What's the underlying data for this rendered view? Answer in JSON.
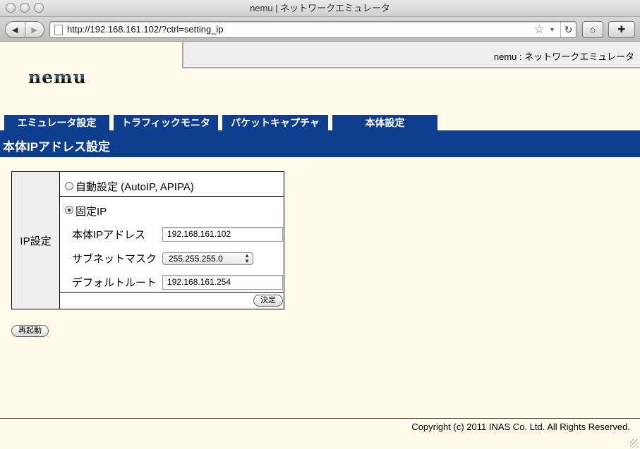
{
  "window": {
    "title": "nemu | ネットワークエミュレータ"
  },
  "browser": {
    "url": "http://192.168.161.102/?ctrl=setting_ip",
    "back_icon": "◀",
    "forward_icon": "▶",
    "star_icon": "☆",
    "dropdown_icon": "▾",
    "reload_icon": "↻",
    "home_icon": "⌂",
    "bookmarks_icon": "✚"
  },
  "header": {
    "title": "nemu : ネットワークエミュレータ",
    "logo": "nemu"
  },
  "tabs": [
    {
      "label": "エミュレータ設定"
    },
    {
      "label": "トラフィックモニタ"
    },
    {
      "label": "パケットキャプチャ"
    },
    {
      "label": "本体設定"
    }
  ],
  "section": {
    "title": "本体IPアドレス設定"
  },
  "form": {
    "row_label": "IP設定",
    "auto_option": {
      "label": "自動設定 (AutoIP, APIPA)",
      "checked": false
    },
    "static_option": {
      "label": "固定IP",
      "checked": true
    },
    "fields": {
      "ip_label": "本体IPアドレス",
      "ip_value": "192.168.161.102",
      "mask_label": "サブネットマスク",
      "mask_value": "255.255.255.0",
      "gateway_label": "デフォルトルート",
      "gateway_value": "192.168.161.254"
    },
    "submit_label": "決定"
  },
  "reboot_label": "再起動",
  "footer": {
    "copyright": "Copyright (c) 2011 INAS Co. Ltd. All Rights Reserved."
  },
  "colors": {
    "accent": "#0d3f8e",
    "page_bg": "#fffbea",
    "header_bg": "#eeeeee"
  }
}
